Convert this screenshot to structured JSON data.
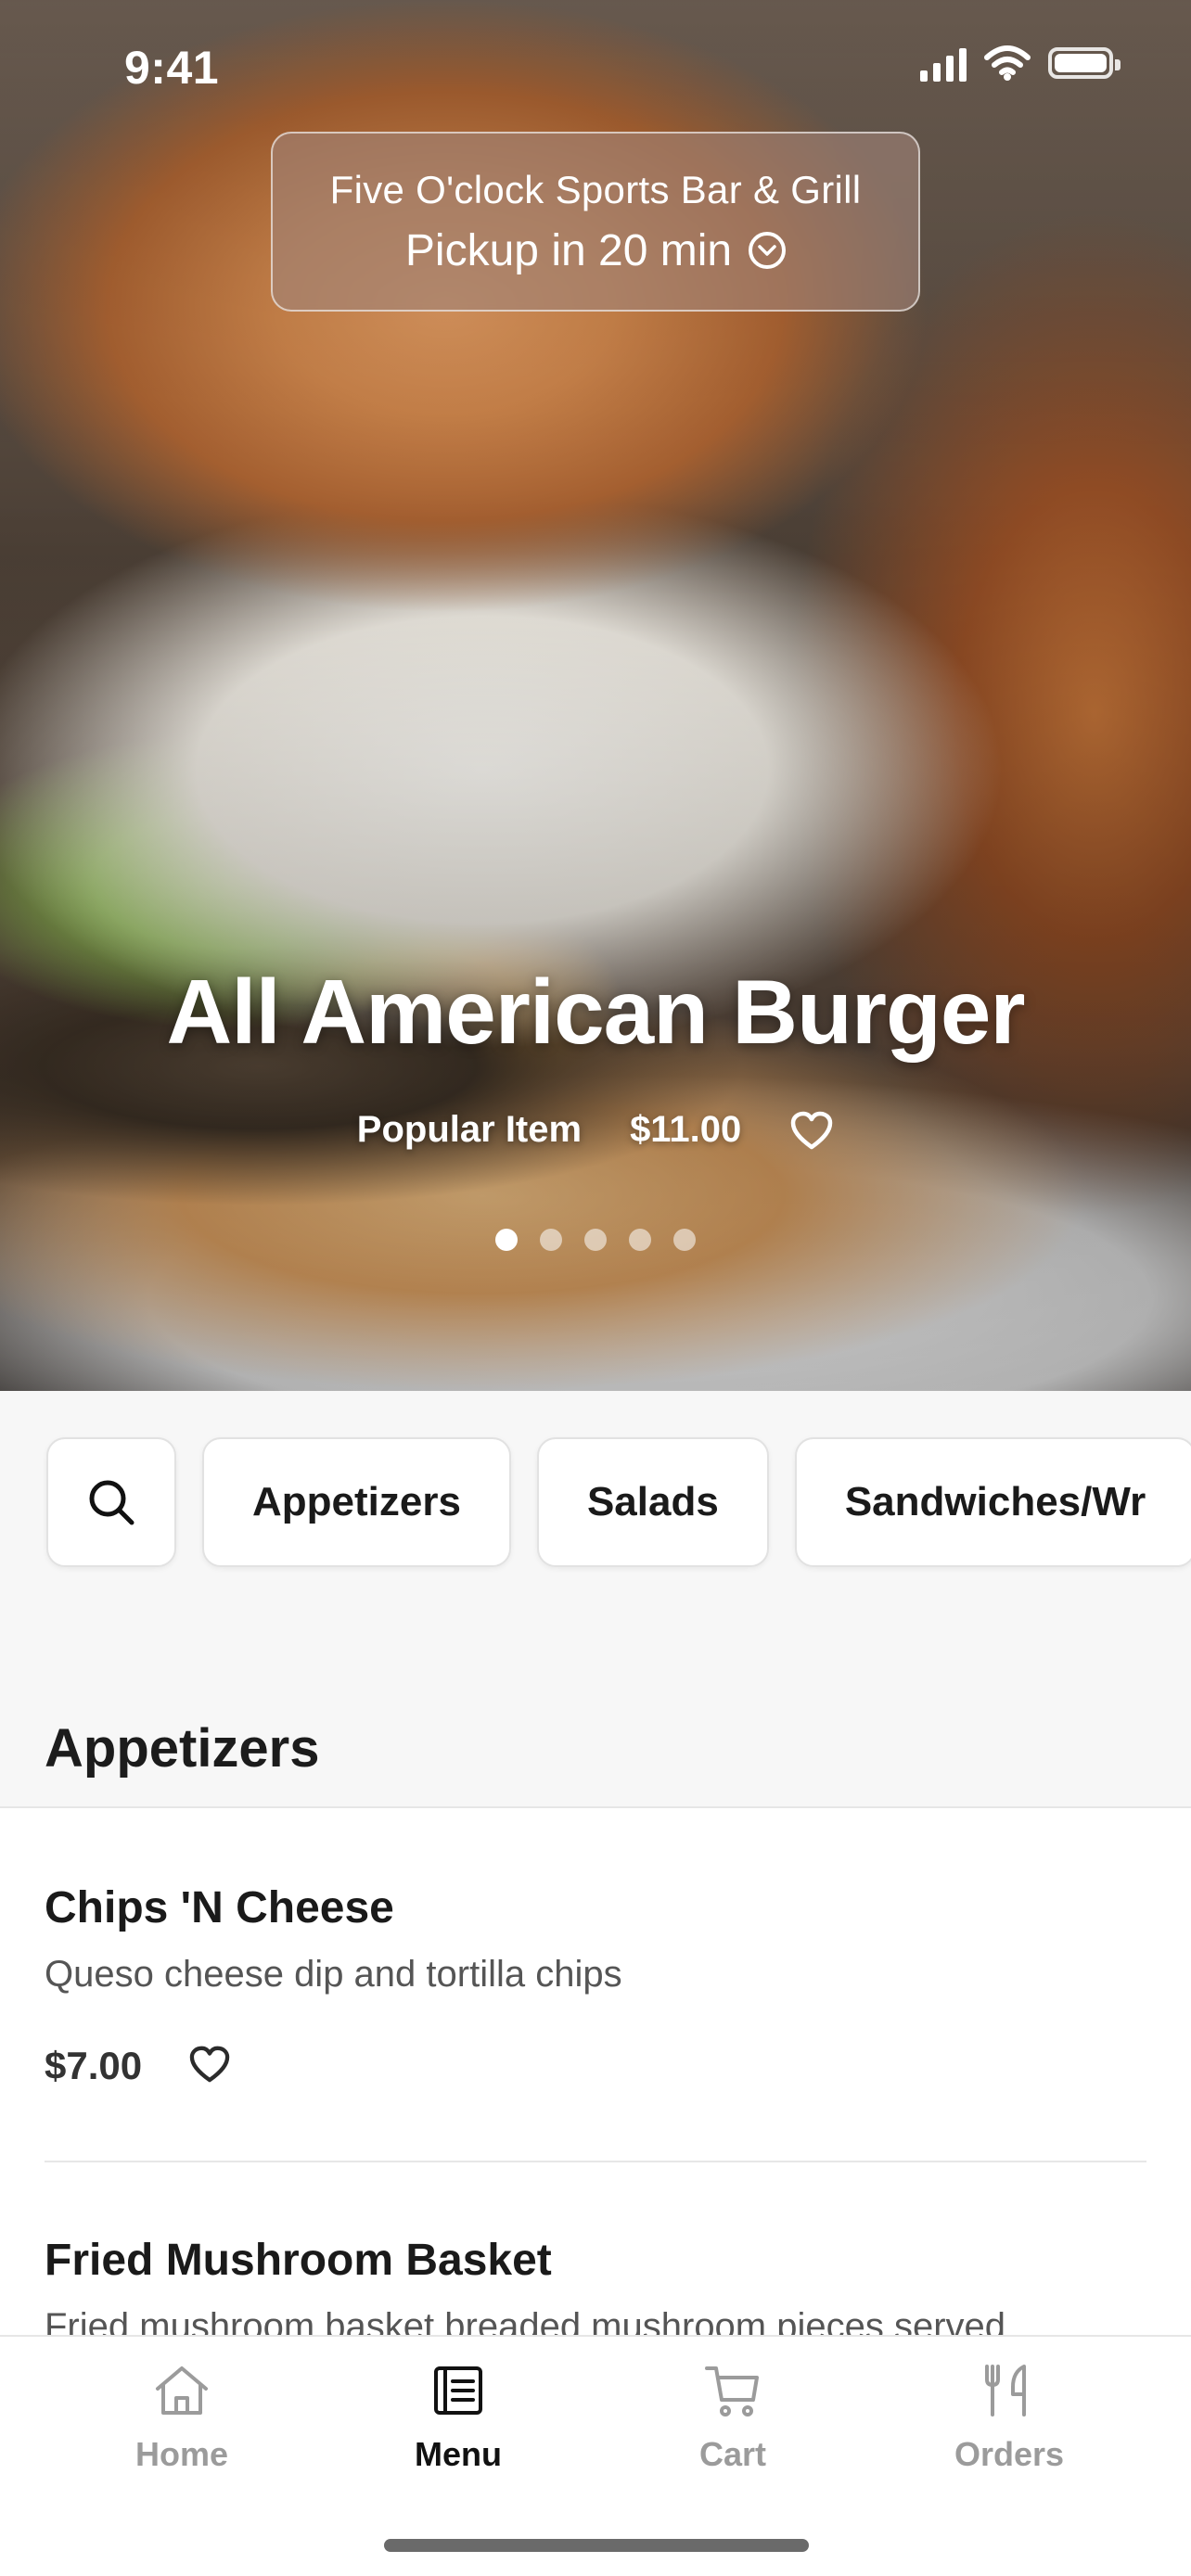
{
  "status_bar": {
    "time": "9:41"
  },
  "header": {
    "restaurant": "Five O'clock Sports Bar & Grill",
    "pickup": "Pickup in 20 min"
  },
  "hero": {
    "title": "All American Burger",
    "tag": "Popular Item",
    "price": "$11.00",
    "carousel": {
      "count": 5,
      "active_index": 0
    }
  },
  "categories": {
    "items": [
      "Appetizers",
      "Salads",
      "Sandwiches/Wr"
    ]
  },
  "section": {
    "title": "Appetizers"
  },
  "menu_items": [
    {
      "name": "Chips 'N Cheese",
      "description": "Queso cheese dip and tortilla chips",
      "price": "$7.00"
    },
    {
      "name": "Fried Mushroom Basket",
      "description": "Fried mushroom basket breaded mushroom pieces served"
    }
  ],
  "tabbar": {
    "items": [
      {
        "label": "Home",
        "icon": "home-icon"
      },
      {
        "label": "Menu",
        "icon": "menu-icon"
      },
      {
        "label": "Cart",
        "icon": "cart-icon"
      },
      {
        "label": "Orders",
        "icon": "orders-icon"
      }
    ],
    "active": "Menu"
  },
  "colors": {
    "accent": "#111111",
    "muted": "#9b9b9b",
    "background": "#f7f7f7"
  }
}
